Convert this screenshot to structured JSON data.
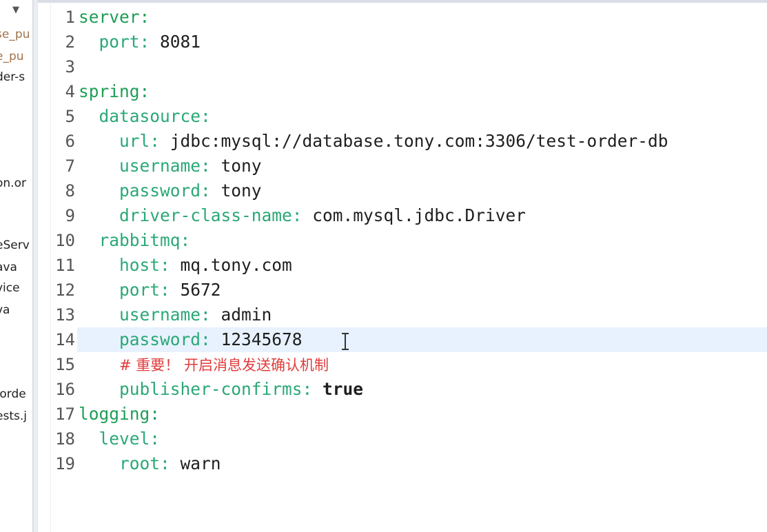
{
  "sidebar": {
    "collapse_icon": "triangle-down-icon",
    "items": [
      {
        "label": "se_pu",
        "muted": true
      },
      {
        "label": "e_pu",
        "muted": true
      },
      {
        "label": "der-s",
        "muted": false
      },
      {
        "label": "on.or",
        "muted": false
      },
      {
        "label": "eServ",
        "muted": false
      },
      {
        "label": "ava",
        "muted": false
      },
      {
        "label": "vice",
        "muted": false
      },
      {
        "label": "va",
        "muted": false
      },
      {
        "label": ".orde",
        "muted": false
      },
      {
        "label": "ests.j",
        "muted": false
      }
    ]
  },
  "editor": {
    "current_line": 14,
    "lines": [
      {
        "number": "1",
        "indent": "",
        "key": "server:",
        "value": ""
      },
      {
        "number": "2",
        "indent": "  ",
        "key": "port:",
        "value": " 8081"
      },
      {
        "number": "3",
        "indent": "",
        "key": "",
        "value": ""
      },
      {
        "number": "4",
        "indent": "",
        "key": "spring:",
        "value": ""
      },
      {
        "number": "5",
        "indent": "  ",
        "key": "datasource:",
        "value": ""
      },
      {
        "number": "6",
        "indent": "    ",
        "key": "url:",
        "value": " jdbc:mysql://database.tony.com:3306/test-order-db"
      },
      {
        "number": "7",
        "indent": "    ",
        "key": "username:",
        "value": " tony"
      },
      {
        "number": "8",
        "indent": "    ",
        "key": "password:",
        "value": " tony"
      },
      {
        "number": "9",
        "indent": "    ",
        "key": "driver-class-name:",
        "value": " com.mysql.jdbc.Driver"
      },
      {
        "number": "10",
        "indent": "  ",
        "key": "rabbitmq:",
        "value": ""
      },
      {
        "number": "11",
        "indent": "    ",
        "key": "host:",
        "value": " mq.tony.com"
      },
      {
        "number": "12",
        "indent": "    ",
        "key": "port:",
        "value": " 5672"
      },
      {
        "number": "13",
        "indent": "    ",
        "key": "username:",
        "value": " admin"
      },
      {
        "number": "14",
        "indent": "    ",
        "key": "password:",
        "value": " 12345678"
      },
      {
        "number": "15",
        "indent": "    ",
        "comment": "# 重要！ 开启消息发送确认机制"
      },
      {
        "number": "16",
        "indent": "    ",
        "key": "publisher-confirms:",
        "value": " true",
        "bool": true
      },
      {
        "number": "17",
        "indent": "",
        "key": "logging:",
        "value": ""
      },
      {
        "number": "18",
        "indent": "  ",
        "key": "level:",
        "value": ""
      },
      {
        "number": "19",
        "indent": "    ",
        "key": "root:",
        "value": " warn"
      }
    ]
  },
  "colors": {
    "key": "#1e9e56",
    "comment": "#e03c3c",
    "current_line_bg": "#e8f2fe",
    "line_number": "#555555"
  },
  "cursor": {
    "icon": "text-cursor-icon"
  }
}
